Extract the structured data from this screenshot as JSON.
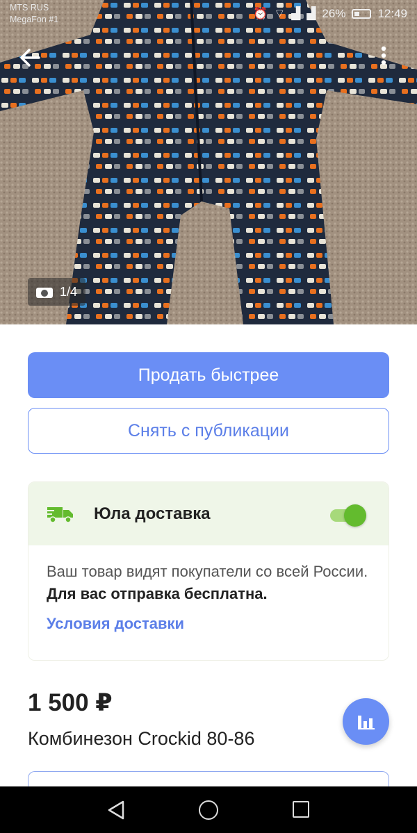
{
  "statusbar": {
    "carrier_line1": "MTS RUS",
    "carrier_line2": "MegaFon #1",
    "battery": "26%",
    "time": "12:49"
  },
  "photo": {
    "counter": "1/4"
  },
  "actions": {
    "sell_faster": "Продать быстрее",
    "unpublish": "Снять с публикации"
  },
  "delivery": {
    "title": "Юла доставка",
    "enabled": true,
    "text_plain": "Ваш товар видят покупатели со всей России. ",
    "text_bold": "Для вас отправка бесплатна.",
    "link": "Условия доставки"
  },
  "listing": {
    "price": "1 500 ₽",
    "title": "Комбинезон Crockid 80-86"
  },
  "colors": {
    "primary": "#6a8ef5",
    "toggle_on": "#63bb2e",
    "delivery_bg": "#eff6e8"
  },
  "icons": [
    "back-arrow-icon",
    "more-vert-icon",
    "camera-icon",
    "truck-icon",
    "stats-icon",
    "nav-back-icon",
    "nav-home-icon",
    "nav-recent-icon"
  ]
}
